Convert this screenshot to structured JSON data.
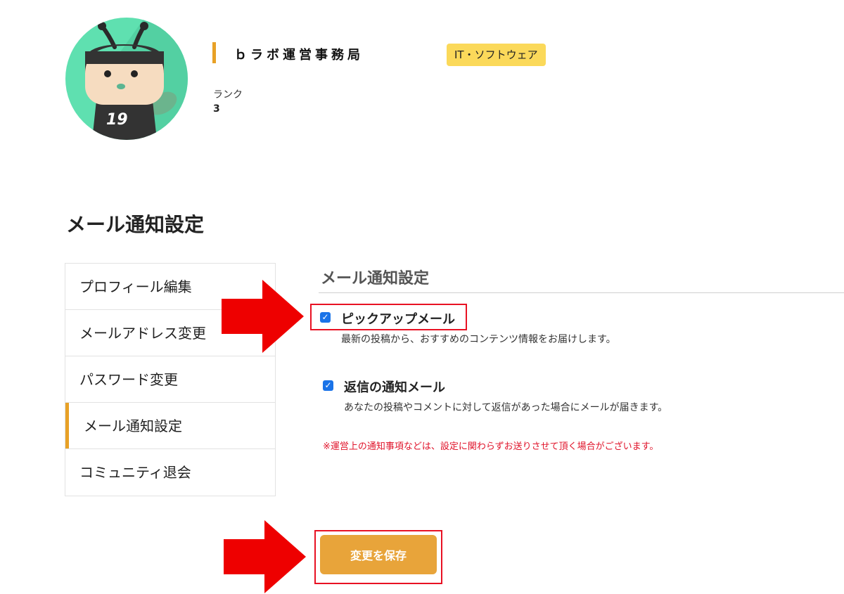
{
  "profile": {
    "name": "ｂラボ運営事務局",
    "category": "IT・ソフトウェア",
    "rank_label": "ランク",
    "rank_value": "3",
    "avatar_number": "19"
  },
  "page_title": "メール通知設定",
  "sidebar": {
    "items": [
      {
        "label": "プロフィール編集"
      },
      {
        "label": "メールアドレス変更"
      },
      {
        "label": "パスワード変更"
      },
      {
        "label": "メール通知設定",
        "active": true
      },
      {
        "label": "コミュニティ退会"
      }
    ]
  },
  "settings": {
    "title": "メール通知設定",
    "options": [
      {
        "label": "ピックアップメール",
        "description": "最新の投稿から、おすすめのコンテンツ情報をお届けします。",
        "checked": true
      },
      {
        "label": "返信の通知メール",
        "description": "あなたの投稿やコメントに対して返信があった場合にメールが届きます。",
        "checked": true
      }
    ],
    "notice": "※運営上の通知事項などは、設定に関わらずお送りさせて頂く場合がございます。",
    "save_label": "変更を保存"
  },
  "colors": {
    "accent": "#e8a126",
    "tag_bg": "#fbd95a",
    "save_button": "#e8a43a",
    "notice_text": "#e0132a",
    "annotation_red": "#e81123",
    "checkbox": "#1a73e8"
  }
}
